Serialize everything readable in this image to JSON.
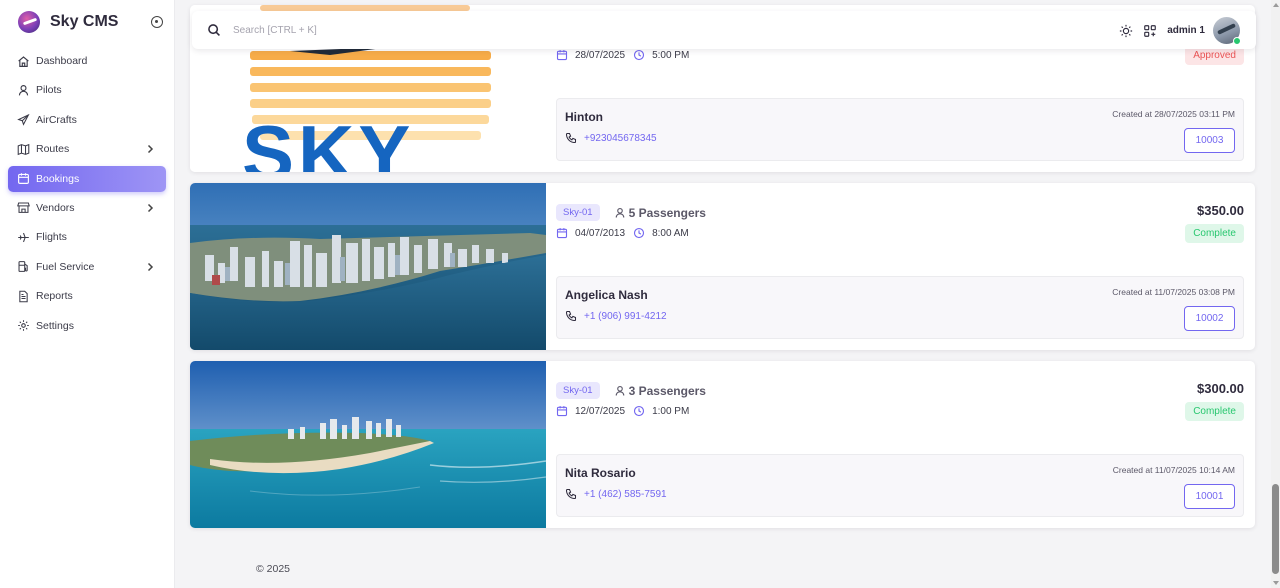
{
  "app": {
    "title": "Sky CMS"
  },
  "sidebar": {
    "items": [
      {
        "label": "Dashboard",
        "icon": "home-icon",
        "active": false,
        "has_children": false
      },
      {
        "label": "Pilots",
        "icon": "user-icon",
        "active": false,
        "has_children": false
      },
      {
        "label": "AirCrafts",
        "icon": "plane-icon",
        "active": false,
        "has_children": false
      },
      {
        "label": "Routes",
        "icon": "map-icon",
        "active": false,
        "has_children": true
      },
      {
        "label": "Bookings",
        "icon": "calendar-icon",
        "active": true,
        "has_children": false
      },
      {
        "label": "Vendors",
        "icon": "store-icon",
        "active": false,
        "has_children": true
      },
      {
        "label": "Flights",
        "icon": "plane-icon",
        "active": false,
        "has_children": false
      },
      {
        "label": "Fuel Service",
        "icon": "fuel-icon",
        "active": false,
        "has_children": true
      },
      {
        "label": "Reports",
        "icon": "report-icon",
        "active": false,
        "has_children": false
      },
      {
        "label": "Settings",
        "icon": "gear-icon",
        "active": false,
        "has_children": false
      }
    ]
  },
  "topbar": {
    "search_placeholder": "Search [CTRL + K]",
    "username": "admin 1",
    "online": true
  },
  "colors": {
    "primary": "#7367f0",
    "success": "#28c76f",
    "danger": "#ea5455"
  },
  "bookings": [
    {
      "image": "sky-logo",
      "tag": "",
      "passengers": "",
      "date": "28/07/2025",
      "time": "5:00 PM",
      "price": "",
      "status": "Approved",
      "status_kind": "approved",
      "customer": "Hinton",
      "phone": "+923045678345",
      "created": "Created at 28/07/2025 03:11 PM",
      "booking_id": "10003"
    },
    {
      "image": "city-waterfront",
      "tag": "Sky-01",
      "passengers": "5 Passengers",
      "date": "04/07/2013",
      "time": "8:00 AM",
      "price": "$350.00",
      "status": "Complete",
      "status_kind": "complete",
      "customer": "Angelica Nash",
      "phone": "+1 (906) 991-4212",
      "created": "Created at 11/07/2025 03:08 PM",
      "booking_id": "10002"
    },
    {
      "image": "coastline",
      "tag": "Sky-01",
      "passengers": "3 Passengers",
      "date": "12/07/2025",
      "time": "1:00 PM",
      "price": "$300.00",
      "status": "Complete",
      "status_kind": "complete",
      "customer": "Nita Rosario",
      "phone": "+1 (462) 585-7591",
      "created": "Created at 11/07/2025 10:14 AM",
      "booking_id": "10001"
    }
  ],
  "footer": {
    "copyright": "© 2025"
  }
}
